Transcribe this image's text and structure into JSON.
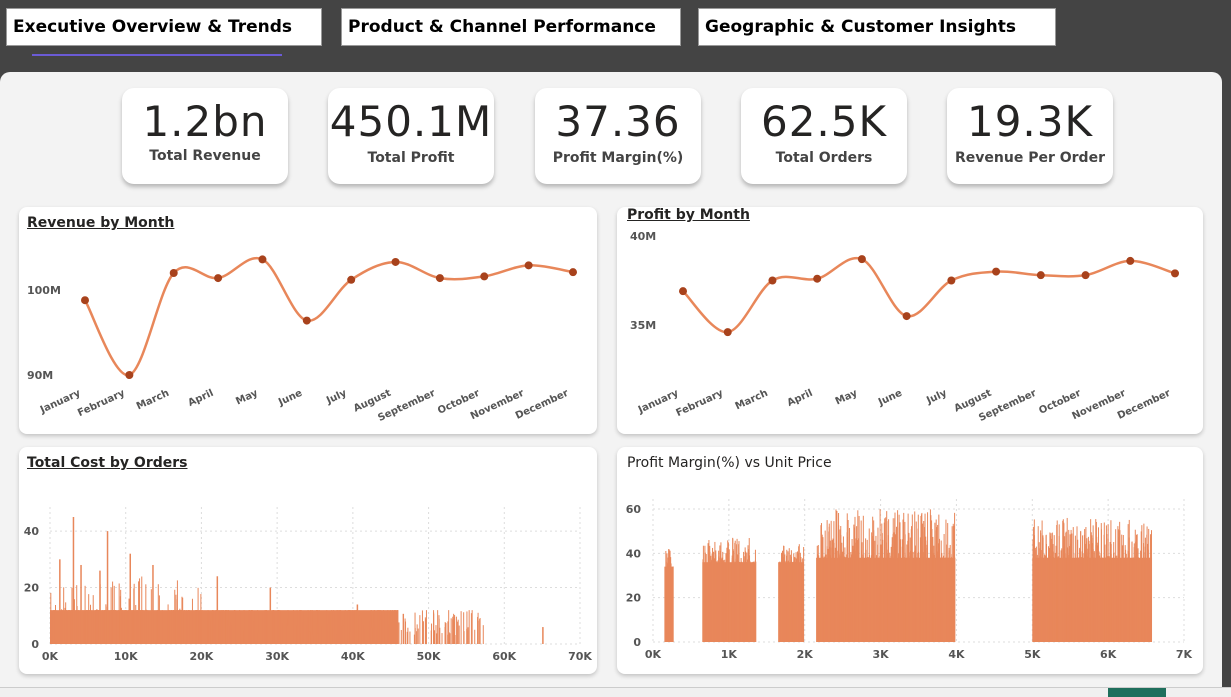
{
  "tabs": [
    {
      "label": "Executive Overview & Trends"
    },
    {
      "label": "Product & Channel Performance"
    },
    {
      "label": "Geographic & Customer Insights"
    }
  ],
  "kpis": [
    {
      "value": "1.2bn",
      "label": "Total Revenue"
    },
    {
      "value": "450.1M",
      "label": "Total Profit"
    },
    {
      "value": "37.36",
      "label": "Profit Margin(%)"
    },
    {
      "value": "62.5K",
      "label": "Total Orders"
    },
    {
      "value": "19.3K",
      "label": "Revenue Per Order"
    }
  ],
  "colors": {
    "series": "#e8875a",
    "marker": "#a8421c",
    "accent": "#6b5bd6"
  },
  "chart_data": [
    {
      "type": "line",
      "title": "Revenue by Month",
      "categories": [
        "January",
        "February",
        "March",
        "April",
        "May",
        "June",
        "July",
        "August",
        "September",
        "October",
        "November",
        "December"
      ],
      "values": [
        98.8,
        90.0,
        102.0,
        101.4,
        103.6,
        96.4,
        101.2,
        103.3,
        101.4,
        101.6,
        102.9,
        102.1
      ],
      "ylim": [
        90,
        100
      ],
      "yticks": [
        "100M",
        "90M"
      ],
      "grid": false
    },
    {
      "type": "line",
      "title": "Profit by Month",
      "categories": [
        "January",
        "February",
        "March",
        "April",
        "May",
        "June",
        "July",
        "August",
        "September",
        "October",
        "November",
        "December"
      ],
      "values": [
        36.9,
        34.6,
        37.5,
        37.6,
        38.7,
        35.5,
        37.5,
        38.0,
        37.8,
        37.8,
        38.6,
        37.9
      ],
      "ylim": [
        35,
        40
      ],
      "yticks": [
        "40M",
        "35M"
      ],
      "grid": false
    },
    {
      "type": "bar",
      "title": "Total Cost by Orders",
      "xticks": [
        "0K",
        "10K",
        "20K",
        "30K",
        "40K",
        "50K",
        "60K",
        "70K"
      ],
      "xlim": [
        0,
        70000
      ],
      "yticks": [
        "40",
        "20",
        "0"
      ],
      "ylim": [
        0,
        45
      ],
      "grid": true
    },
    {
      "type": "bar",
      "title": "Profit Margin(%) vs Unit Price",
      "xticks": [
        "0K",
        "1K",
        "2K",
        "3K",
        "4K",
        "5K",
        "6K",
        "7K"
      ],
      "xlim": [
        0,
        7000
      ],
      "yticks": [
        "60",
        "40",
        "20",
        "0"
      ],
      "ylim": [
        0,
        60
      ],
      "grid": true
    }
  ]
}
